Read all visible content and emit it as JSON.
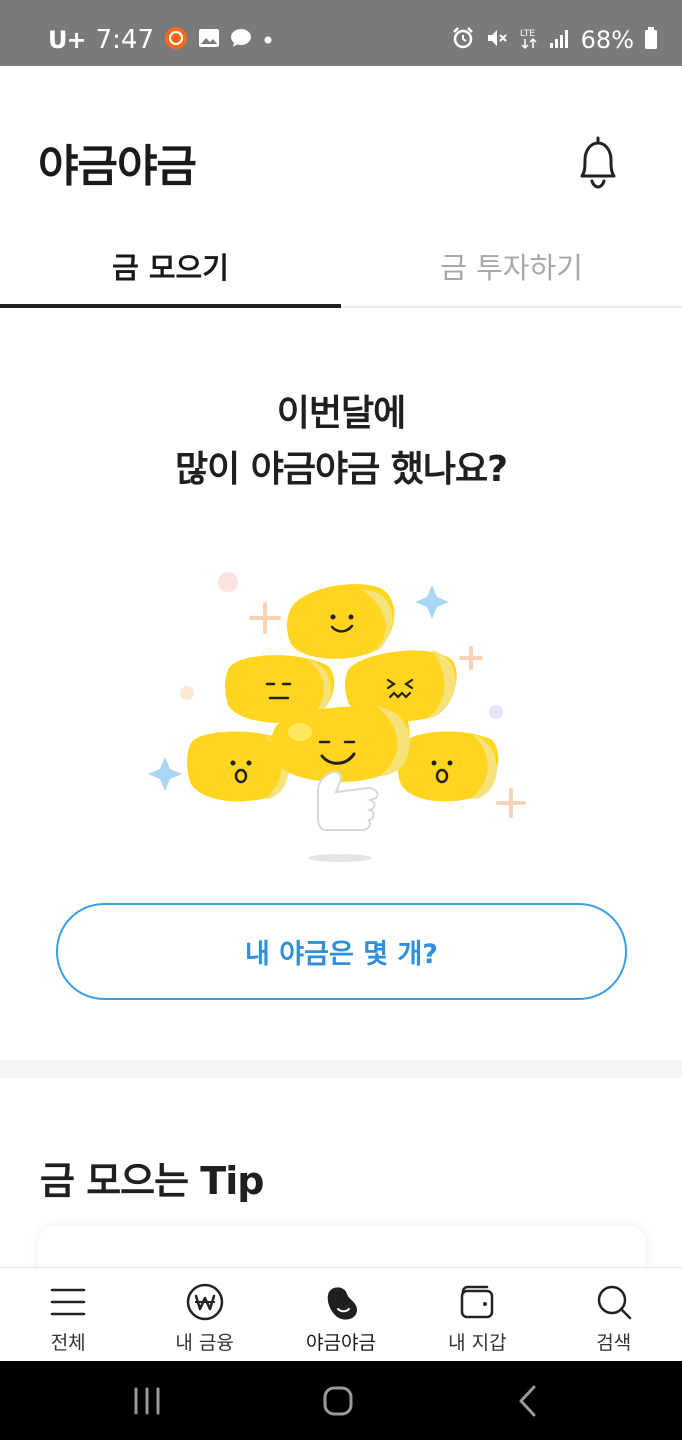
{
  "status_bar": {
    "carrier": "U+",
    "time": "7:47",
    "battery": "68%",
    "icons": [
      "record-icon",
      "gallery-icon",
      "chat-icon",
      "dot-icon",
      "alarm-icon",
      "mute-icon",
      "lte-icon",
      "signal-icon",
      "battery-icon"
    ]
  },
  "header": {
    "title": "야금야금",
    "bell_icon": "bell-icon"
  },
  "tabs": [
    {
      "label": "금 모으기",
      "active": true
    },
    {
      "label": "금 투자하기",
      "active": false
    }
  ],
  "hero": {
    "line1": "이번달에",
    "line2": "많이 야금야금 했나요?",
    "illustration": "gold-beans-thumbs-up"
  },
  "cta": {
    "label": "내 야금은 몇 개?"
  },
  "tips": {
    "title": "금 모으는 Tip"
  },
  "bottom_nav": [
    {
      "label": "전체",
      "icon": "menu-icon",
      "active": false
    },
    {
      "label": "내 금융",
      "icon": "won-icon",
      "active": false
    },
    {
      "label": "야금야금",
      "icon": "bean-icon",
      "active": true
    },
    {
      "label": "내 지갑",
      "icon": "wallet-icon",
      "active": false
    },
    {
      "label": "검색",
      "icon": "search-icon",
      "active": false
    }
  ],
  "system_nav": [
    "recent-apps-icon",
    "home-icon",
    "back-icon"
  ],
  "colors": {
    "accent_blue": "#2f8fda",
    "gold": "#ffd51f",
    "status_bar": "#7a7a7a"
  }
}
